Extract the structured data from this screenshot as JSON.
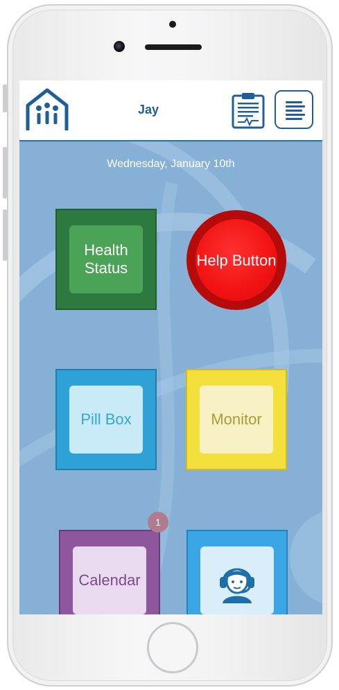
{
  "header": {
    "user_name": "Jay",
    "logo_icon": "house-people-logo-icon",
    "report_icon": "clipboard-report-icon",
    "menu_icon": "hamburger-menu-icon"
  },
  "date_label": "Wednesday, January 10th",
  "tiles": {
    "health_status": "Health Status",
    "help_button": "Help Button",
    "pill_box": "Pill Box",
    "monitor": "Monitor",
    "calendar": "Calendar",
    "support_icon": "headset-agent-icon"
  },
  "calendar_badge": "1",
  "colors": {
    "brand": "#1f5f96",
    "background": "#86b0d6",
    "health": "#2c7a3e",
    "help": "#f11313",
    "pill": "#2ea1d6",
    "monitor": "#f3e03c",
    "calendar": "#8e569c",
    "support": "#3aa6e6"
  }
}
